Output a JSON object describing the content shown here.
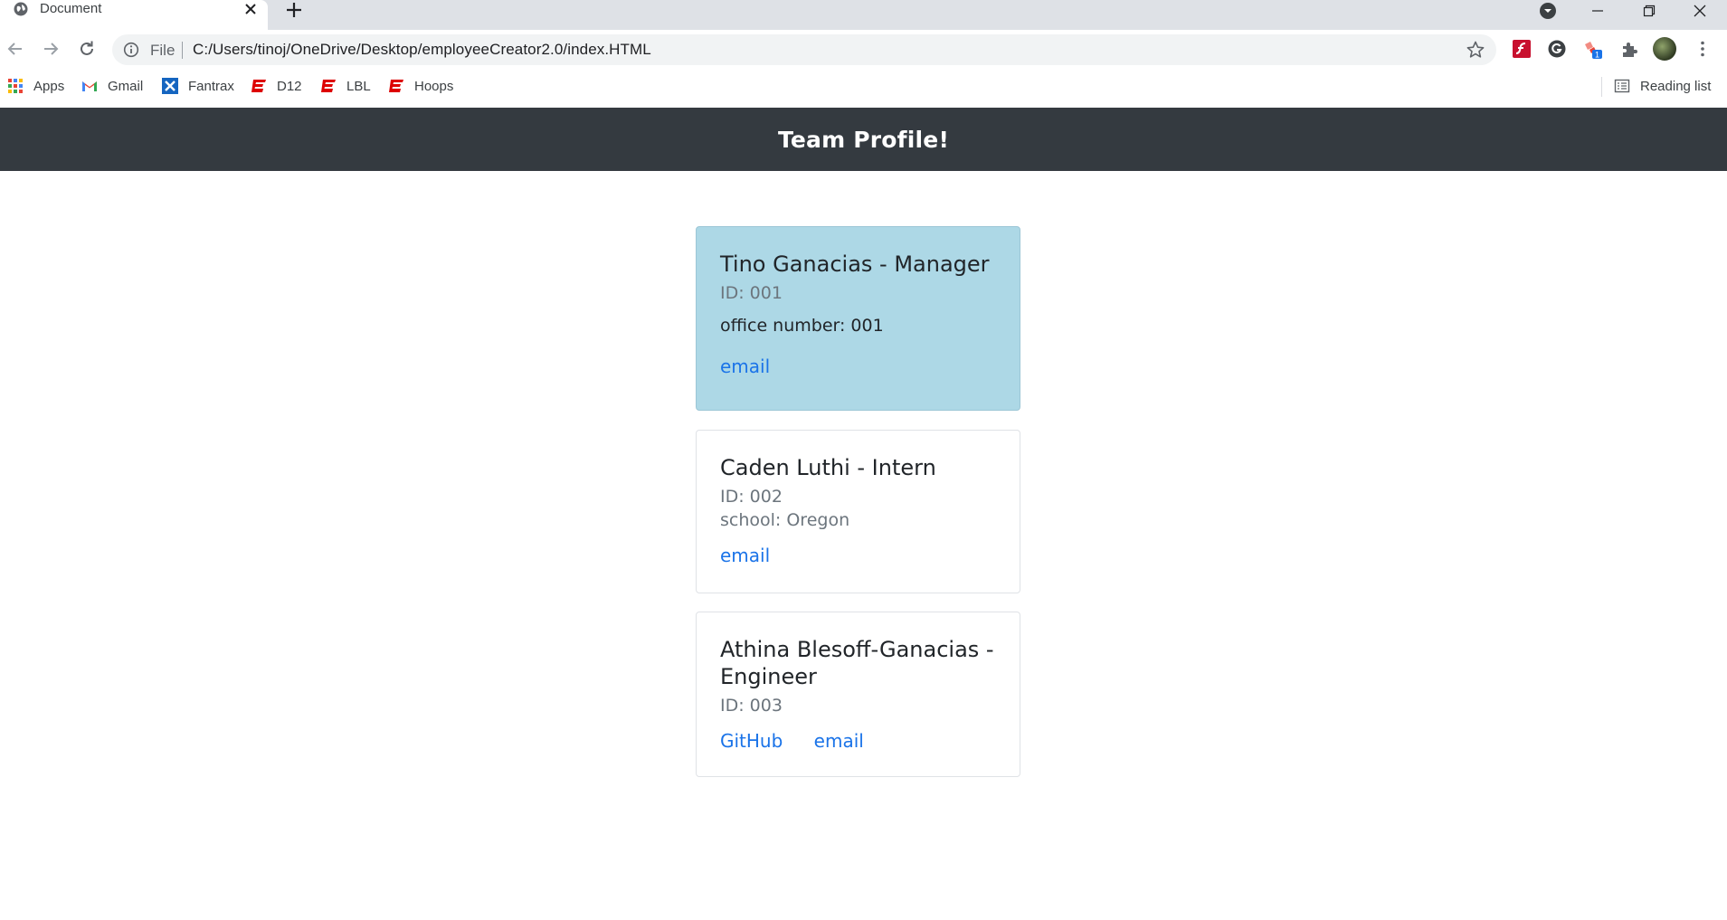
{
  "browser": {
    "tab_title": "Document",
    "omnibox_scheme": "File",
    "url": "C:/Users/tinoj/OneDrive/Desktop/employeeCreator2.0/index.HTML",
    "bookmarks": [
      {
        "label": "Apps",
        "icon": "apps-grid-icon"
      },
      {
        "label": "Gmail",
        "icon": "gmail-icon"
      },
      {
        "label": "Fantrax",
        "icon": "fantrax-icon"
      },
      {
        "label": "D12",
        "icon": "espn-icon"
      },
      {
        "label": "LBL",
        "icon": "espn-icon"
      },
      {
        "label": "Hoops",
        "icon": "espn-icon"
      }
    ],
    "reading_list": "Reading list",
    "extension_badge": "1"
  },
  "page": {
    "header_title": "Team Profile!",
    "cards": [
      {
        "title": "Tino Ganacias - Manager",
        "id": "ID: 001",
        "detail": "office number: 001",
        "links": [
          "email"
        ],
        "bg": "#add8e6"
      },
      {
        "title": "Caden Luthi - Intern",
        "id": "ID: 002",
        "detail": "school: Oregon",
        "links": [
          "email"
        ]
      },
      {
        "title": "Athina Blesoff-Ganacias - Engineer",
        "id": "ID: 003",
        "links": [
          "GitHub",
          "email"
        ]
      }
    ]
  },
  "colors": {
    "header_bg": "#343a40",
    "link": "#1a73e8",
    "manager_card": "#add8e6"
  }
}
